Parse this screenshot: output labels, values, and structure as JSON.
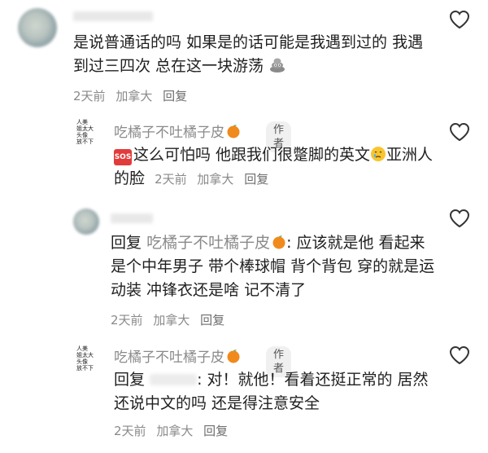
{
  "comments": [
    {
      "text": "是说普通话的吗 如果是的话可能是我遇到过的 我遇到过三四次 总在这一块游荡",
      "emoji": "poop-icon",
      "time": "2天前",
      "location": "加拿大",
      "reply_label": "回复"
    },
    {
      "username": "吃橘子不吐橘子皮",
      "badge": "作者",
      "avatar_text": "人美\n姐太大\n头像\n放不下",
      "prefix_icon": "sos-icon",
      "prefix_icon_label": "SOS",
      "text_part1": "这么可怕吗 他跟我们很蹩脚的英文",
      "emoji": "crying-face-icon",
      "text_part2": "亚洲人的脸",
      "time": "2天前",
      "location": "加拿大",
      "reply_label": "回复"
    },
    {
      "reply_prefix": "回复",
      "mention": "吃橘子不吐橘子皮",
      "mention_emoji": "orange-icon",
      "text": ": 应该就是他 看起来是个中年男子 带个棒球帽 背个背包 穿的就是运动装 冲锋衣还是啥 记不清了",
      "time": "2天前",
      "location": "加拿大",
      "reply_label": "回复"
    },
    {
      "username": "吃橘子不吐橘子皮",
      "badge": "作者",
      "avatar_text": "人美\n姐太大\n头像\n放不下",
      "reply_prefix": "回复",
      "text": ": 对！就他！看着还挺正常的 居然还说中文的吗 还是得注意安全",
      "time": "2天前",
      "location": "加拿大",
      "reply_label": "回复"
    }
  ]
}
